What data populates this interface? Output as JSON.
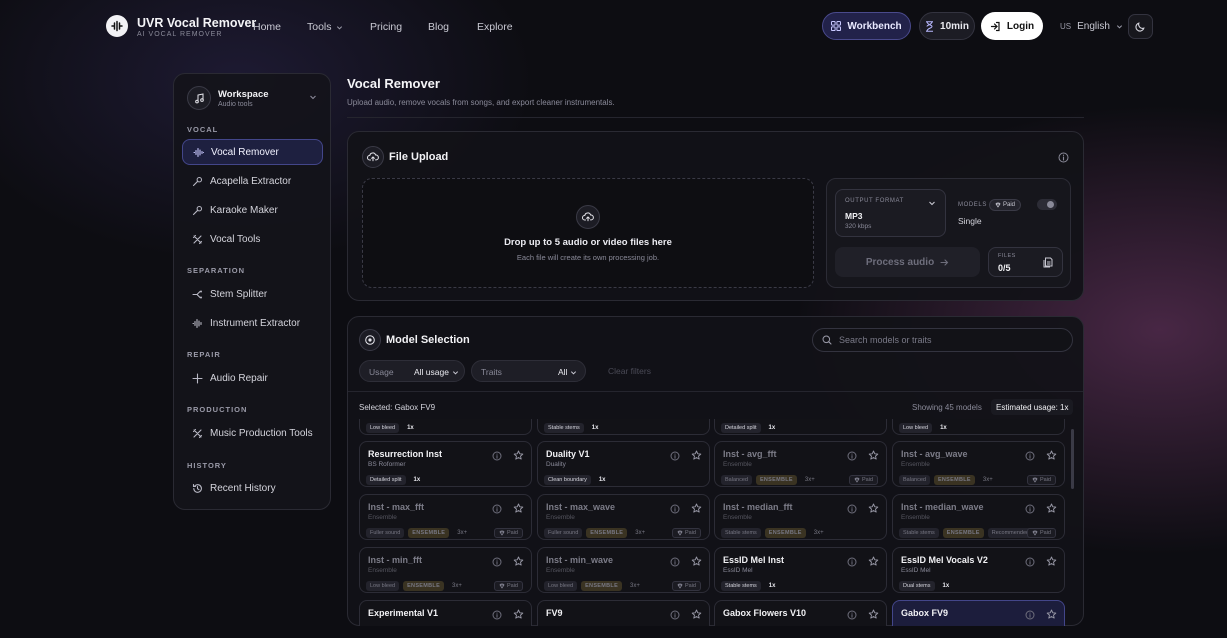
{
  "header": {
    "brand_title": "UVR Vocal Remover",
    "brand_sub": "AI VOCAL REMOVER",
    "nav": [
      {
        "label": "Home"
      },
      {
        "label": "Tools"
      },
      {
        "label": "Pricing"
      },
      {
        "label": "Blog"
      },
      {
        "label": "Explore"
      }
    ],
    "workbench_label": "Workbench",
    "timer_label": "10min",
    "login_label": "Login",
    "lang_code": "US",
    "lang_label": "English"
  },
  "sidebar": {
    "workspace_title": "Workspace",
    "workspace_sub": "Audio tools",
    "sections": {
      "vocal": "VOCAL",
      "separation": "SEPARATION",
      "repair": "REPAIR",
      "production": "PRODUCTION",
      "history": "HISTORY"
    },
    "items": [
      {
        "label": "Vocal Remover",
        "icon": "waveform-icon",
        "active": true
      },
      {
        "label": "Acapella Extractor",
        "icon": "microphone-icon"
      },
      {
        "label": "Karaoke Maker",
        "icon": "microphone-icon"
      },
      {
        "label": "Vocal Tools",
        "icon": "tools-icon"
      },
      {
        "label": "Stem Splitter",
        "icon": "split-icon"
      },
      {
        "label": "Instrument Extractor",
        "icon": "waveform-icon"
      },
      {
        "label": "Audio Repair",
        "icon": "sparkle-icon"
      },
      {
        "label": "Music Production Tools",
        "icon": "tools-icon"
      },
      {
        "label": "Recent History",
        "icon": "history-icon"
      }
    ]
  },
  "main": {
    "title": "Vocal Remover",
    "subtitle": "Upload audio, remove vocals from songs, and export cleaner instrumentals.",
    "upload": {
      "title": "File Upload",
      "drop_title": "Drop up to 5 audio or video files here",
      "drop_sub": "Each file will create its own processing job.",
      "output_format_label": "OUTPUT FORMAT",
      "output_format_value": "MP3",
      "output_format_sub": "320 kbps",
      "models_label": "MODELS",
      "paid_label": "Paid",
      "models_value": "Single",
      "process_label": "Process audio",
      "files_label": "FILES",
      "files_value": "0/5"
    },
    "models": {
      "title": "Model Selection",
      "search_placeholder": "Search models or traits",
      "usage_label": "Usage",
      "usage_value": "All usage",
      "traits_label": "Traits",
      "traits_value": "All",
      "clear_label": "Clear filters",
      "selected_text": "Selected: Gabox FV9",
      "showing_text": "Showing 45 models",
      "estimated_text": "Estimated usage: 1x",
      "cards": [
        {
          "name": "",
          "sub": "",
          "tags": [
            "Low bleed"
          ],
          "ensemble": false,
          "mult": "1x",
          "paid": false,
          "dim": false,
          "selected": false
        },
        {
          "name": "",
          "sub": "",
          "tags": [
            "Stable stems"
          ],
          "ensemble": false,
          "mult": "1x",
          "paid": false,
          "dim": false,
          "selected": false
        },
        {
          "name": "",
          "sub": "",
          "tags": [
            "Detailed split"
          ],
          "ensemble": false,
          "mult": "1x",
          "paid": false,
          "dim": false,
          "selected": false
        },
        {
          "name": "",
          "sub": "",
          "tags": [
            "Low bleed"
          ],
          "ensemble": false,
          "mult": "1x",
          "paid": false,
          "dim": false,
          "selected": false
        },
        {
          "name": "Resurrection Inst",
          "sub": "BS Roformer",
          "tags": [
            "Detailed split"
          ],
          "ensemble": false,
          "mult": "1x",
          "paid": false,
          "dim": false,
          "selected": false
        },
        {
          "name": "Duality V1",
          "sub": "Duality",
          "tags": [
            "Clean boundary"
          ],
          "ensemble": false,
          "mult": "1x",
          "paid": false,
          "dim": false,
          "selected": false
        },
        {
          "name": "Inst - avg_fft",
          "sub": "Ensemble",
          "tags": [
            "Balanced"
          ],
          "ensemble": true,
          "mult": "3x+",
          "paid": true,
          "dim": true,
          "selected": false
        },
        {
          "name": "Inst - avg_wave",
          "sub": "Ensemble",
          "tags": [
            "Balanced"
          ],
          "ensemble": true,
          "mult": "3x+",
          "paid": true,
          "dim": true,
          "selected": false
        },
        {
          "name": "Inst - max_fft",
          "sub": "Ensemble",
          "tags": [
            "Fuller sound"
          ],
          "ensemble": true,
          "mult": "3x+",
          "paid": true,
          "dim": true,
          "selected": false
        },
        {
          "name": "Inst - max_wave",
          "sub": "Ensemble",
          "tags": [
            "Fuller sound"
          ],
          "ensemble": true,
          "mult": "3x+",
          "paid": true,
          "dim": true,
          "selected": false
        },
        {
          "name": "Inst - median_fft",
          "sub": "Ensemble",
          "tags": [
            "Stable stems"
          ],
          "ensemble": true,
          "mult": "3x+",
          "paid": false,
          "dim": true,
          "selected": false
        },
        {
          "name": "Inst - median_wave",
          "sub": "Ensemble",
          "tags": [
            "Stable stems",
            "Recommended"
          ],
          "ensemble": true,
          "mult": "",
          "paid": true,
          "dim": true,
          "selected": false
        },
        {
          "name": "Inst - min_fft",
          "sub": "Ensemble",
          "tags": [
            "Low bleed"
          ],
          "ensemble": true,
          "mult": "3x+",
          "paid": true,
          "dim": true,
          "selected": false
        },
        {
          "name": "Inst - min_wave",
          "sub": "Ensemble",
          "tags": [
            "Low bleed"
          ],
          "ensemble": true,
          "mult": "3x+",
          "paid": true,
          "dim": true,
          "selected": false
        },
        {
          "name": "EssID Mel Inst",
          "sub": "EssID Mel",
          "tags": [
            "Stable stems"
          ],
          "ensemble": false,
          "mult": "1x",
          "paid": false,
          "dim": false,
          "selected": false
        },
        {
          "name": "EssID Mel Vocals V2",
          "sub": "EssID Mel",
          "tags": [
            "Dual stems"
          ],
          "ensemble": false,
          "mult": "1x",
          "paid": false,
          "dim": false,
          "selected": false
        },
        {
          "name": "Experimental V1",
          "sub": "",
          "tags": [],
          "ensemble": false,
          "mult": "",
          "paid": false,
          "dim": false,
          "selected": false
        },
        {
          "name": "FV9",
          "sub": "",
          "tags": [],
          "ensemble": false,
          "mult": "",
          "paid": false,
          "dim": false,
          "selected": false
        },
        {
          "name": "Gabox Flowers V10",
          "sub": "",
          "tags": [],
          "ensemble": false,
          "mult": "",
          "paid": false,
          "dim": false,
          "selected": false
        },
        {
          "name": "Gabox FV9",
          "sub": "",
          "tags": [],
          "ensemble": false,
          "mult": "",
          "paid": false,
          "dim": false,
          "selected": true
        }
      ],
      "ensemble_label": "ENSEMBLE",
      "paid_label": "Paid"
    }
  },
  "colors": {
    "accent": "#43468a",
    "active_bg": "#1e2040",
    "ensemble": "#b9a777",
    "background": "#0d0d12"
  }
}
